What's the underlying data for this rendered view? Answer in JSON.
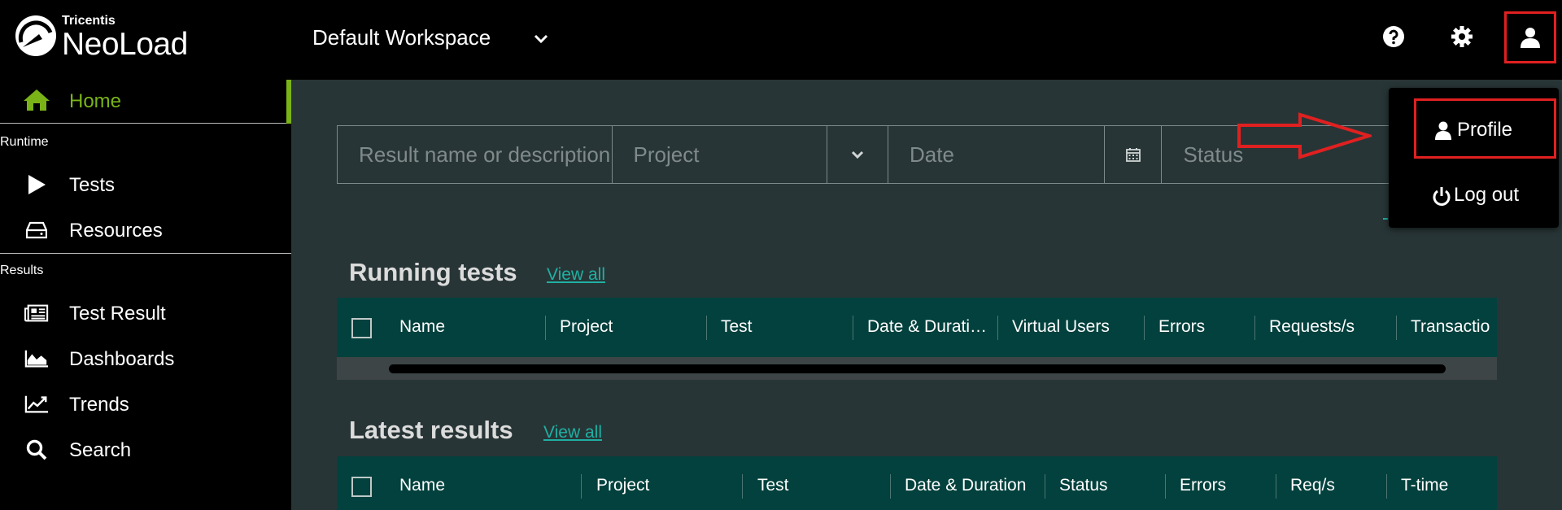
{
  "app": {
    "brand_small": "Tricentis",
    "brand_name": "NeoLoad",
    "workspace": "Default Workspace"
  },
  "colors": {
    "accent_green": "#7ab317",
    "teal_header": "#02413d",
    "link": "#1fb0a3",
    "highlight_red": "#e02020"
  },
  "sidebar": {
    "home": {
      "label": "Home",
      "icon": "home-icon"
    },
    "runtime_label": "Runtime",
    "runtime_items": [
      {
        "label": "Tests",
        "icon": "play-icon"
      },
      {
        "label": "Resources",
        "icon": "server-icon"
      }
    ],
    "results_label": "Results",
    "results_items": [
      {
        "label": "Test Result",
        "icon": "newspaper-icon"
      },
      {
        "label": "Dashboards",
        "icon": "area-chart-icon"
      },
      {
        "label": "Trends",
        "icon": "line-chart-icon"
      },
      {
        "label": "Search",
        "icon": "search-icon"
      }
    ]
  },
  "filters": {
    "name_placeholder": "Result name or description",
    "project_placeholder": "Project",
    "date_placeholder": "Date",
    "status_placeholder": "Status"
  },
  "running_tests": {
    "title": "Running tests",
    "view_all": "View all",
    "columns": [
      "Name",
      "Project",
      "Test",
      "Date & Durati…",
      "Virtual Users",
      "Errors",
      "Requests/s",
      "Transactio"
    ]
  },
  "latest_results": {
    "title": "Latest results",
    "view_all": "View all",
    "columns": [
      "Name",
      "Project",
      "Test",
      "Date & Duration",
      "Status",
      "Errors",
      "Req/s",
      "T-time"
    ]
  },
  "user_menu": {
    "profile": "Profile",
    "logout": "Log out"
  }
}
